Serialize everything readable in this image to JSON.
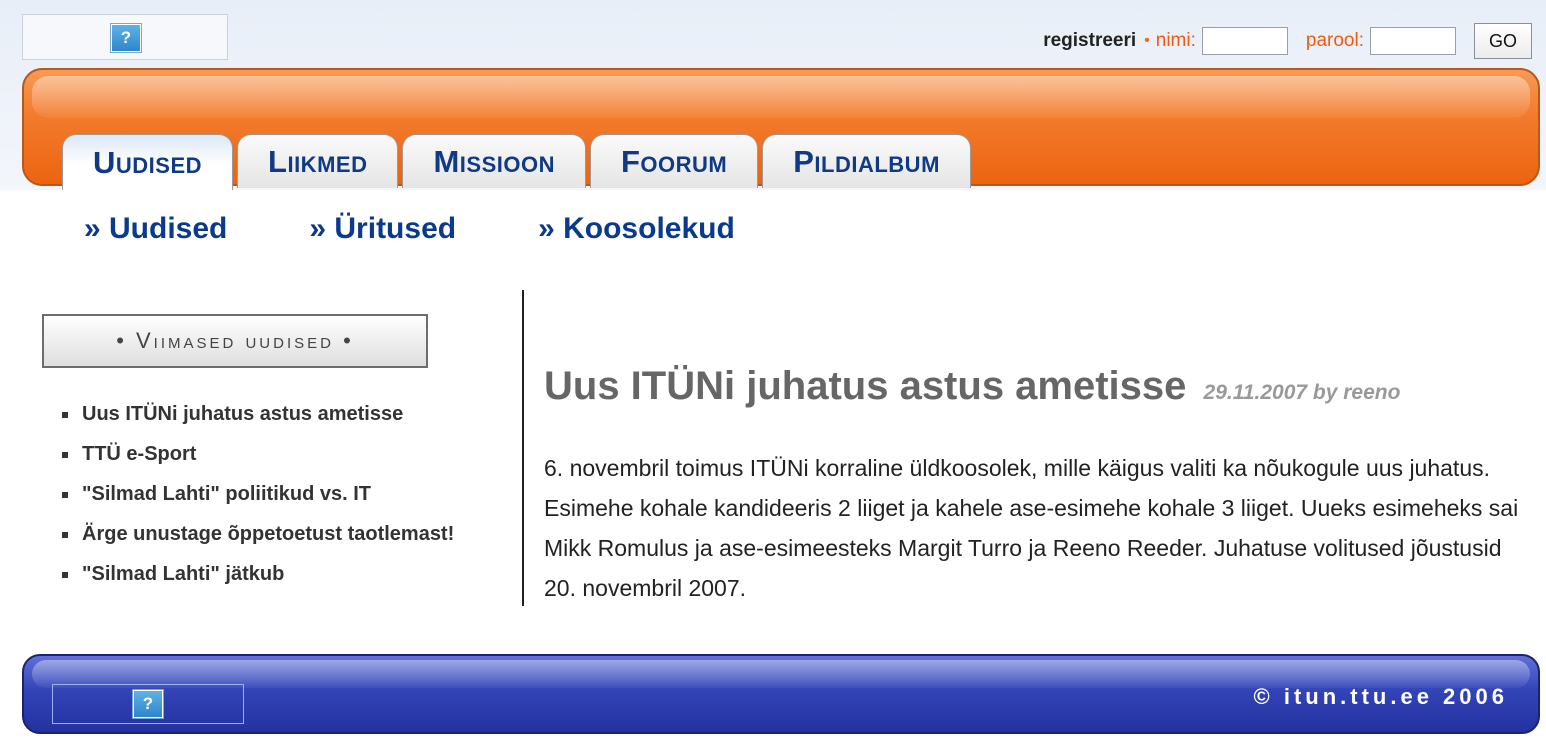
{
  "header": {
    "logo_icon": "broken-image-icon",
    "logo_glyph": "?",
    "register_label": "registreeri",
    "name_label": "nimi:",
    "password_label": "parool:",
    "name_value": "",
    "password_value": "",
    "go_label": "GO",
    "accent_color": "#ee5a12"
  },
  "tabs": [
    {
      "label": "Uudised",
      "active": true
    },
    {
      "label": "Liikmed",
      "active": false
    },
    {
      "label": "Missioon",
      "active": false
    },
    {
      "label": "Foorum",
      "active": false
    },
    {
      "label": "Pildialbum",
      "active": false
    }
  ],
  "subnav": [
    {
      "label": "» Uudised"
    },
    {
      "label": "» Üritused"
    },
    {
      "label": "» Koosolekud"
    }
  ],
  "sidebar": {
    "header": "• Viimased uudised •",
    "items": [
      {
        "label": "Uus ITÜNi juhatus astus ametisse"
      },
      {
        "label": "TTÜ e-Sport"
      },
      {
        "label": "\"Silmad Lahti\" poliitikud vs. IT"
      },
      {
        "label": "Ärge unustage õppetoetust taotlemast!"
      },
      {
        "label": "\"Silmad Lahti\" jätkub"
      }
    ]
  },
  "article": {
    "title": "Uus ITÜNi juhatus astus ametisse",
    "meta": "29.11.2007 by reeno",
    "body": "6. novembril toimus ITÜNi korraline üldkoosolek, mille käigus valiti ka nõukogule uus juhatus. Esimehe kohale kandideeris 2 liiget ja kahele ase-esimehe kohale 3 liiget. Uueks esimeheks sai Mikk Romulus ja ase-esimeesteks Margit Turro ja Reeno Reeder. Juhatuse volitused jõustusid 20. novembril 2007."
  },
  "footer": {
    "logo_icon": "broken-image-icon",
    "logo_glyph": "?",
    "copyright": "© itun.ttu.ee 2006"
  }
}
